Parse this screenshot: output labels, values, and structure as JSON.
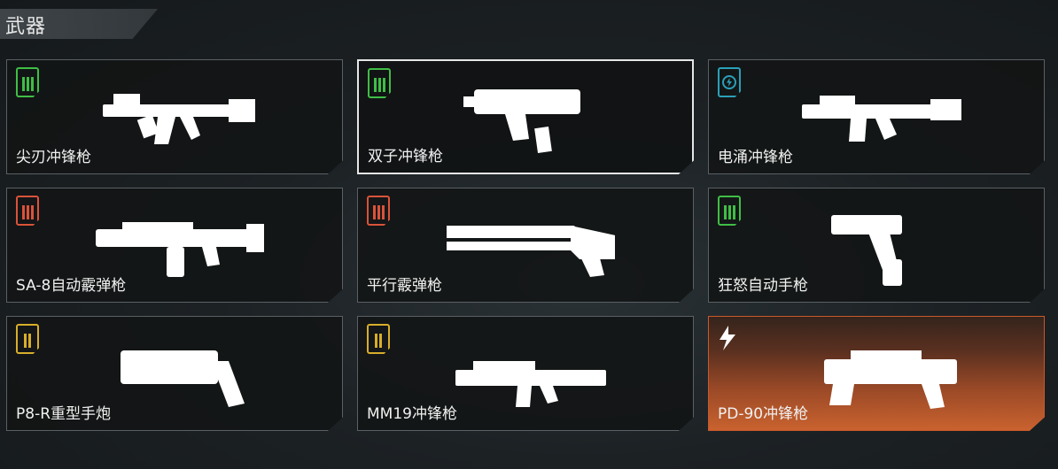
{
  "section": {
    "title": "武器"
  },
  "weapons": [
    {
      "name": "尖刃冲锋枪",
      "ammo": "light",
      "state": "normal"
    },
    {
      "name": "双子冲锋枪",
      "ammo": "light",
      "state": "selected"
    },
    {
      "name": "电涌冲锋枪",
      "ammo": "energy",
      "state": "normal"
    },
    {
      "name": "SA-8自动霰弹枪",
      "ammo": "shotgun",
      "state": "normal"
    },
    {
      "name": "平行霰弹枪",
      "ammo": "shotgun",
      "state": "normal"
    },
    {
      "name": "狂怒自动手枪",
      "ammo": "light",
      "state": "normal"
    },
    {
      "name": "P8-R重型手炮",
      "ammo": "heavy",
      "state": "normal"
    },
    {
      "name": "MM19冲锋枪",
      "ammo": "heavy",
      "state": "normal"
    },
    {
      "name": "PD-90冲锋枪",
      "ammo": "special",
      "state": "highlight"
    }
  ],
  "colors": {
    "light_ammo": "#3fbe46",
    "shotgun_ammo": "#d9533a",
    "heavy_ammo": "#d8ae2a",
    "energy_ammo": "#2aa0b8",
    "highlight": "#c9622f"
  }
}
